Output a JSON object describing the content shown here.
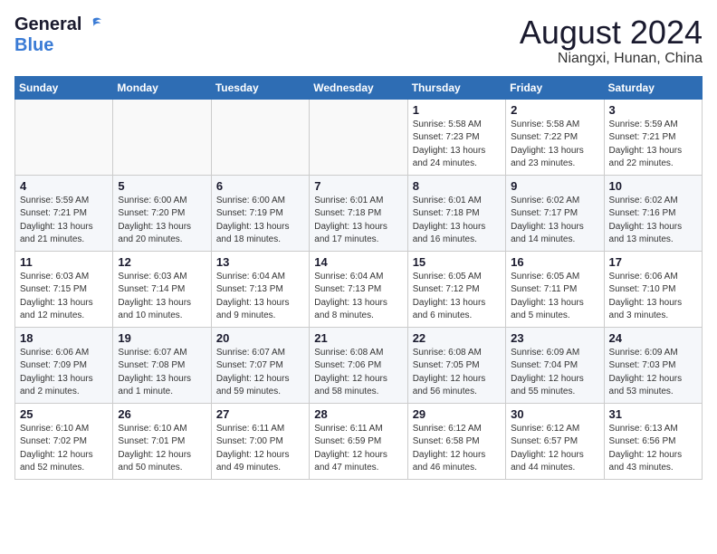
{
  "logo": {
    "general": "General",
    "blue": "Blue"
  },
  "title": "August 2024",
  "location": "Niangxi, Hunan, China",
  "days_of_week": [
    "Sunday",
    "Monday",
    "Tuesday",
    "Wednesday",
    "Thursday",
    "Friday",
    "Saturday"
  ],
  "weeks": [
    [
      {
        "day": "",
        "info": ""
      },
      {
        "day": "",
        "info": ""
      },
      {
        "day": "",
        "info": ""
      },
      {
        "day": "",
        "info": ""
      },
      {
        "day": "1",
        "info": "Sunrise: 5:58 AM\nSunset: 7:23 PM\nDaylight: 13 hours\nand 24 minutes."
      },
      {
        "day": "2",
        "info": "Sunrise: 5:58 AM\nSunset: 7:22 PM\nDaylight: 13 hours\nand 23 minutes."
      },
      {
        "day": "3",
        "info": "Sunrise: 5:59 AM\nSunset: 7:21 PM\nDaylight: 13 hours\nand 22 minutes."
      }
    ],
    [
      {
        "day": "4",
        "info": "Sunrise: 5:59 AM\nSunset: 7:21 PM\nDaylight: 13 hours\nand 21 minutes."
      },
      {
        "day": "5",
        "info": "Sunrise: 6:00 AM\nSunset: 7:20 PM\nDaylight: 13 hours\nand 20 minutes."
      },
      {
        "day": "6",
        "info": "Sunrise: 6:00 AM\nSunset: 7:19 PM\nDaylight: 13 hours\nand 18 minutes."
      },
      {
        "day": "7",
        "info": "Sunrise: 6:01 AM\nSunset: 7:18 PM\nDaylight: 13 hours\nand 17 minutes."
      },
      {
        "day": "8",
        "info": "Sunrise: 6:01 AM\nSunset: 7:18 PM\nDaylight: 13 hours\nand 16 minutes."
      },
      {
        "day": "9",
        "info": "Sunrise: 6:02 AM\nSunset: 7:17 PM\nDaylight: 13 hours\nand 14 minutes."
      },
      {
        "day": "10",
        "info": "Sunrise: 6:02 AM\nSunset: 7:16 PM\nDaylight: 13 hours\nand 13 minutes."
      }
    ],
    [
      {
        "day": "11",
        "info": "Sunrise: 6:03 AM\nSunset: 7:15 PM\nDaylight: 13 hours\nand 12 minutes."
      },
      {
        "day": "12",
        "info": "Sunrise: 6:03 AM\nSunset: 7:14 PM\nDaylight: 13 hours\nand 10 minutes."
      },
      {
        "day": "13",
        "info": "Sunrise: 6:04 AM\nSunset: 7:13 PM\nDaylight: 13 hours\nand 9 minutes."
      },
      {
        "day": "14",
        "info": "Sunrise: 6:04 AM\nSunset: 7:13 PM\nDaylight: 13 hours\nand 8 minutes."
      },
      {
        "day": "15",
        "info": "Sunrise: 6:05 AM\nSunset: 7:12 PM\nDaylight: 13 hours\nand 6 minutes."
      },
      {
        "day": "16",
        "info": "Sunrise: 6:05 AM\nSunset: 7:11 PM\nDaylight: 13 hours\nand 5 minutes."
      },
      {
        "day": "17",
        "info": "Sunrise: 6:06 AM\nSunset: 7:10 PM\nDaylight: 13 hours\nand 3 minutes."
      }
    ],
    [
      {
        "day": "18",
        "info": "Sunrise: 6:06 AM\nSunset: 7:09 PM\nDaylight: 13 hours\nand 2 minutes."
      },
      {
        "day": "19",
        "info": "Sunrise: 6:07 AM\nSunset: 7:08 PM\nDaylight: 13 hours\nand 1 minute."
      },
      {
        "day": "20",
        "info": "Sunrise: 6:07 AM\nSunset: 7:07 PM\nDaylight: 12 hours\nand 59 minutes."
      },
      {
        "day": "21",
        "info": "Sunrise: 6:08 AM\nSunset: 7:06 PM\nDaylight: 12 hours\nand 58 minutes."
      },
      {
        "day": "22",
        "info": "Sunrise: 6:08 AM\nSunset: 7:05 PM\nDaylight: 12 hours\nand 56 minutes."
      },
      {
        "day": "23",
        "info": "Sunrise: 6:09 AM\nSunset: 7:04 PM\nDaylight: 12 hours\nand 55 minutes."
      },
      {
        "day": "24",
        "info": "Sunrise: 6:09 AM\nSunset: 7:03 PM\nDaylight: 12 hours\nand 53 minutes."
      }
    ],
    [
      {
        "day": "25",
        "info": "Sunrise: 6:10 AM\nSunset: 7:02 PM\nDaylight: 12 hours\nand 52 minutes."
      },
      {
        "day": "26",
        "info": "Sunrise: 6:10 AM\nSunset: 7:01 PM\nDaylight: 12 hours\nand 50 minutes."
      },
      {
        "day": "27",
        "info": "Sunrise: 6:11 AM\nSunset: 7:00 PM\nDaylight: 12 hours\nand 49 minutes."
      },
      {
        "day": "28",
        "info": "Sunrise: 6:11 AM\nSunset: 6:59 PM\nDaylight: 12 hours\nand 47 minutes."
      },
      {
        "day": "29",
        "info": "Sunrise: 6:12 AM\nSunset: 6:58 PM\nDaylight: 12 hours\nand 46 minutes."
      },
      {
        "day": "30",
        "info": "Sunrise: 6:12 AM\nSunset: 6:57 PM\nDaylight: 12 hours\nand 44 minutes."
      },
      {
        "day": "31",
        "info": "Sunrise: 6:13 AM\nSunset: 6:56 PM\nDaylight: 12 hours\nand 43 minutes."
      }
    ]
  ]
}
